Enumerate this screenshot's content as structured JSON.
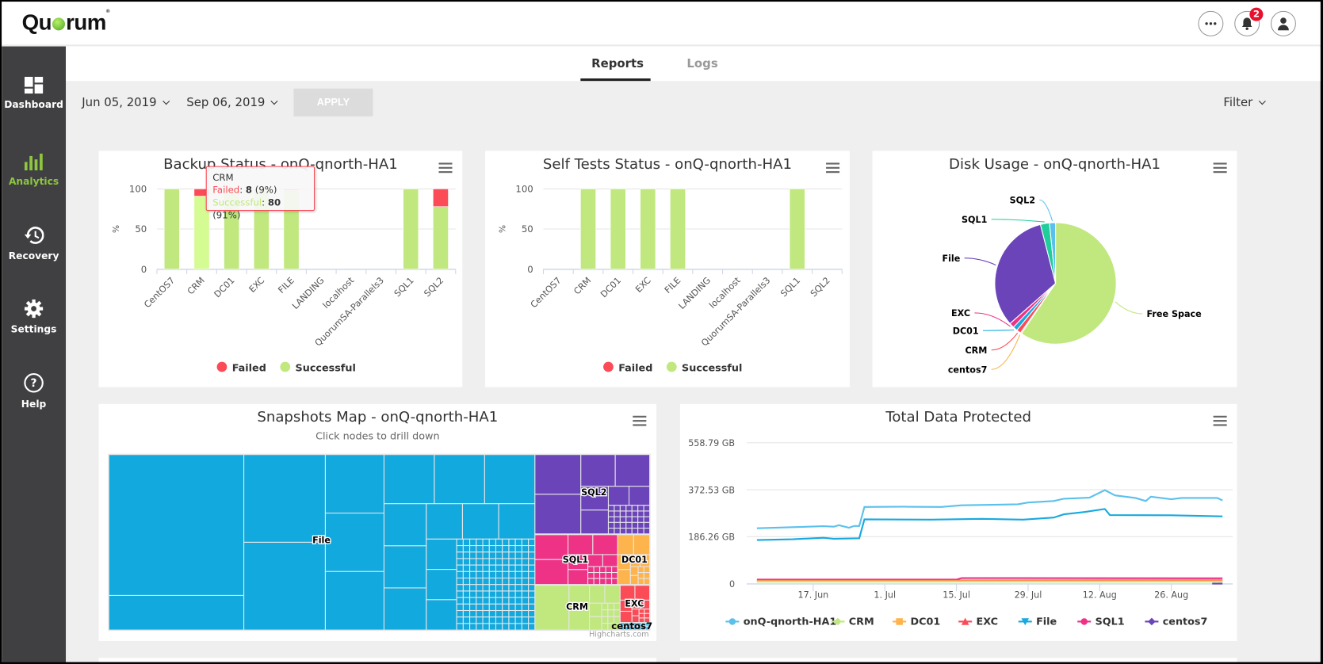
{
  "header": {
    "logo": "Quorum",
    "notifications_count": "2",
    "icons": [
      "more-icon",
      "bell-icon",
      "user-icon"
    ]
  },
  "sidebar": {
    "items": [
      {
        "label": "Dashboard",
        "icon": "dashboard-icon"
      },
      {
        "label": "Analytics",
        "icon": "analytics-icon",
        "active": true
      },
      {
        "label": "Recovery",
        "icon": "recovery-icon"
      },
      {
        "label": "Settings",
        "icon": "gear-icon"
      },
      {
        "label": "Help",
        "icon": "help-icon"
      }
    ],
    "active_color": "#8dc63f"
  },
  "tabs": [
    {
      "label": "Reports",
      "active": true
    },
    {
      "label": "Logs"
    }
  ],
  "toolbar": {
    "start_date": "Jun 05, 2019",
    "end_date": "Sep 06, 2019",
    "apply_label": "APPLY",
    "filter_label": "Filter"
  },
  "chart_data": [
    {
      "type": "bar",
      "stacked": true,
      "title": "Backup Status - onQ-qnorth-HA1",
      "ylabel": "%",
      "ylim": [
        0,
        100
      ],
      "yticks": [
        0,
        50,
        100
      ],
      "categories": [
        "CentOS7",
        "CRM",
        "DC01",
        "EXC",
        "FILE",
        "LANDING",
        "localhost",
        "QuorumSA-Parallels3",
        "SQL1",
        "SQL2"
      ],
      "series": [
        {
          "name": "Failed",
          "color": "#fb4b57",
          "values": [
            0,
            9,
            0,
            0,
            2,
            0,
            0,
            0,
            0,
            22
          ]
        },
        {
          "name": "Successful",
          "color": "#c0e87e",
          "values": [
            100,
            91,
            100,
            100,
            98,
            0,
            0,
            0,
            100,
            78
          ]
        }
      ],
      "legend": "bottom",
      "tooltip": {
        "category": "CRM",
        "failed_label": "Failed",
        "failed_value": "8",
        "failed_pct": "(9%)",
        "success_label": "Successful",
        "success_value": "80",
        "success_pct": "(91%)"
      }
    },
    {
      "type": "bar",
      "stacked": true,
      "title": "Self Tests Status - onQ-qnorth-HA1",
      "ylabel": "%",
      "ylim": [
        0,
        100
      ],
      "yticks": [
        0,
        50,
        100
      ],
      "categories": [
        "CentOS7",
        "CRM",
        "DC01",
        "EXC",
        "FILE",
        "LANDING",
        "localhost",
        "QuorumSA-Parallels3",
        "SQL1",
        "SQL2"
      ],
      "series": [
        {
          "name": "Failed",
          "color": "#fb4b57",
          "values": [
            0,
            0,
            0,
            0,
            0,
            0,
            0,
            0,
            0,
            0
          ]
        },
        {
          "name": "Successful",
          "color": "#c0e87e",
          "values": [
            0,
            100,
            100,
            100,
            100,
            0,
            0,
            0,
            100,
            0
          ]
        }
      ],
      "legend": "bottom"
    },
    {
      "type": "pie",
      "title": "Disk Usage - onQ-qnorth-HA1",
      "slices": [
        {
          "name": "Free Space",
          "value": 59.5,
          "color": "#c0e87e"
        },
        {
          "name": "centos7",
          "value": 0.3,
          "color": "#fdb44d"
        },
        {
          "name": "CRM",
          "value": 1.2,
          "color": "#fb4b57"
        },
        {
          "name": "DC01",
          "value": 1.2,
          "color": "#17a9df"
        },
        {
          "name": "EXC",
          "value": 1.3,
          "color": "#ee3286"
        },
        {
          "name": "File",
          "value": 32.5,
          "color": "#6b44b9"
        },
        {
          "name": "SQL1",
          "value": 2.4,
          "color": "#1fce9a"
        },
        {
          "name": "SQL2",
          "value": 1.6,
          "color": "#5ac1ec"
        }
      ]
    },
    {
      "type": "treemap",
      "title": "Snapshots Map - onQ-qnorth-HA1",
      "subtitle": "Click nodes to drill down",
      "credit": "Highcharts.com",
      "nodes": [
        {
          "name": "File",
          "share": 78.8,
          "color": "#12a9de"
        },
        {
          "name": "SQL2",
          "share": 9.6,
          "color": "#6b44b9"
        },
        {
          "name": "SQL1",
          "share": 4.3,
          "color": "#ee3286"
        },
        {
          "name": "DC01",
          "share": 1.7,
          "color": "#fdb44d"
        },
        {
          "name": "CRM",
          "share": 4.0,
          "color": "#c0e87e"
        },
        {
          "name": "EXC",
          "share": 1.2,
          "color": "#fb4b57"
        },
        {
          "name": "centos7",
          "share": 0.3,
          "color": "#5ac1ec"
        }
      ]
    },
    {
      "type": "line",
      "title": "Total Data Protected",
      "xlim": [
        "2019-06-04",
        "2019-09-07"
      ],
      "xticks": [
        {
          "date": "2019-06-17",
          "label": "17. Jun"
        },
        {
          "date": "2019-07-01",
          "label": "1. Jul"
        },
        {
          "date": "2019-07-15",
          "label": "15. Jul"
        },
        {
          "date": "2019-07-29",
          "label": "29. Jul"
        },
        {
          "date": "2019-08-12",
          "label": "12. Aug"
        },
        {
          "date": "2019-08-26",
          "label": "26. Aug"
        }
      ],
      "ylim": [
        0,
        558.79
      ],
      "yticks": [
        {
          "value": 0,
          "label": "0"
        },
        {
          "value": 186.26,
          "label": "186.26 GB"
        },
        {
          "value": 372.53,
          "label": "372.53 GB"
        },
        {
          "value": 558.79,
          "label": "558.79 GB"
        }
      ],
      "legend": "bottom",
      "series": [
        {
          "name": "onQ-qnorth-HA1",
          "color": "#5ac1ec",
          "marker": "circle",
          "points": [
            [
              "2019-06-06",
              220
            ],
            [
              "2019-06-13",
              224
            ],
            [
              "2019-06-19",
              228
            ],
            [
              "2019-06-21",
              226
            ],
            [
              "2019-06-22",
              232
            ],
            [
              "2019-06-24",
              222
            ],
            [
              "2019-06-25",
              229
            ],
            [
              "2019-06-26",
              229
            ],
            [
              "2019-06-27",
              304
            ],
            [
              "2019-07-05",
              305
            ],
            [
              "2019-07-12",
              304
            ],
            [
              "2019-07-16",
              311
            ],
            [
              "2019-07-22",
              313
            ],
            [
              "2019-07-27",
              315
            ],
            [
              "2019-07-29",
              322
            ],
            [
              "2019-08-03",
              328
            ],
            [
              "2019-08-05",
              337
            ],
            [
              "2019-08-10",
              341
            ],
            [
              "2019-08-13",
              371
            ],
            [
              "2019-08-15",
              350
            ],
            [
              "2019-08-19",
              340
            ],
            [
              "2019-08-21",
              328
            ],
            [
              "2019-08-22",
              345
            ],
            [
              "2019-08-26",
              335
            ],
            [
              "2019-08-28",
              340
            ],
            [
              "2019-09-04",
              340
            ],
            [
              "2019-09-05",
              330
            ]
          ]
        },
        {
          "name": "CRM",
          "color": "#c0e87e",
          "marker": "diamond",
          "points": [
            [
              "2019-06-06",
              8
            ],
            [
              "2019-09-05",
              8
            ]
          ]
        },
        {
          "name": "DC01",
          "color": "#fdb44d",
          "marker": "square",
          "points": [
            [
              "2019-06-06",
              10
            ],
            [
              "2019-09-05",
              10
            ]
          ]
        },
        {
          "name": "EXC",
          "color": "#fb4b57",
          "marker": "triangle",
          "points": [
            [
              "2019-06-06",
              12
            ],
            [
              "2019-09-05",
              13
            ]
          ]
        },
        {
          "name": "File",
          "color": "#17a9df",
          "marker": "triangle-down",
          "points": [
            [
              "2019-06-06",
              173
            ],
            [
              "2019-06-13",
              176
            ],
            [
              "2019-06-19",
              182
            ],
            [
              "2019-06-21",
              178
            ],
            [
              "2019-06-26",
              180
            ],
            [
              "2019-06-27",
              255
            ],
            [
              "2019-07-10",
              254
            ],
            [
              "2019-07-20",
              257
            ],
            [
              "2019-07-28",
              254
            ],
            [
              "2019-08-03",
              262
            ],
            [
              "2019-08-05",
              275
            ],
            [
              "2019-08-09",
              284
            ],
            [
              "2019-08-13",
              296
            ],
            [
              "2019-08-14",
              272
            ],
            [
              "2019-08-26",
              271
            ],
            [
              "2019-09-05",
              267
            ]
          ]
        },
        {
          "name": "SQL1",
          "color": "#ee3286",
          "marker": "circle",
          "points": [
            [
              "2019-06-06",
              16
            ],
            [
              "2019-07-15",
              16
            ],
            [
              "2019-07-16",
              22
            ],
            [
              "2019-09-05",
              21
            ]
          ]
        },
        {
          "name": "centos7",
          "color": "#6b44b9",
          "marker": "diamond",
          "points": [
            [
              "2019-09-03",
              0
            ],
            [
              "2019-09-05",
              0
            ]
          ]
        }
      ]
    }
  ]
}
